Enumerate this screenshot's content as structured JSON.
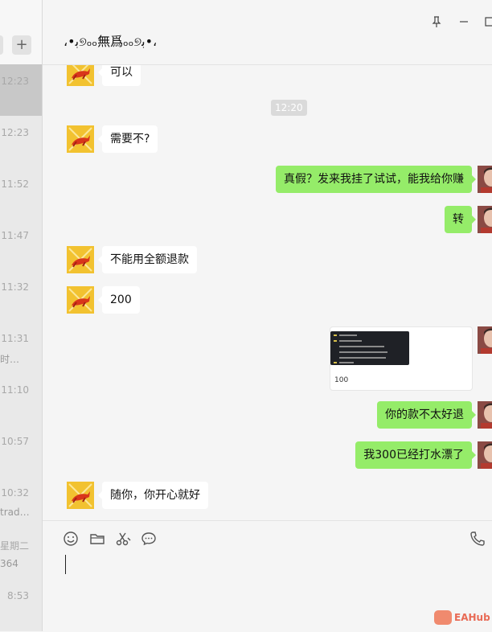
{
  "sidebar": {
    "plus_label": "+",
    "items": [
      {
        "time": "12:23",
        "active": true
      },
      {
        "time": "12:23"
      },
      {
        "time": "11:52"
      },
      {
        "time": "11:47"
      },
      {
        "time": "11:32"
      },
      {
        "time": "11:31",
        "preview": "时…"
      },
      {
        "time": "11:10"
      },
      {
        "time": "10:57"
      },
      {
        "time": "10:32",
        "preview": "trad…"
      },
      {
        "time": "星期二",
        "preview": "364"
      },
      {
        "time": "8:53"
      }
    ]
  },
  "chat": {
    "title": "،•ﺑ୭ₒₒ無爲ₒₒ୭ﺑ•،",
    "window_controls": {
      "pin": "⊥",
      "minimize": "—",
      "close": "□"
    },
    "timestamp": "12:20",
    "messages": [
      {
        "side": "in",
        "text": "可以"
      },
      {
        "side": "in",
        "text": "需要不?"
      },
      {
        "side": "out",
        "text": "真假？发来我挂了试试，能我给你赚"
      },
      {
        "side": "out",
        "text": "转"
      },
      {
        "side": "in",
        "text": "不能用全额退款"
      },
      {
        "side": "in",
        "text": "200"
      },
      {
        "side": "out",
        "type": "file",
        "count": "100"
      },
      {
        "side": "out",
        "text": "你的款不太好退"
      },
      {
        "side": "out",
        "text": "我300已经打水漂了"
      },
      {
        "side": "in",
        "text": "随你，你开心就好"
      }
    ]
  },
  "toolbar": {
    "icons": [
      "emoji-icon",
      "folder-icon",
      "scissors-icon",
      "chat-bubble-icon",
      "phone-icon"
    ]
  },
  "watermark": {
    "text": "EAHub"
  },
  "colors": {
    "out_bubble": "#95ec69",
    "in_bubble": "#ffffff",
    "background": "#f5f5f5",
    "sidebar": "#e9e9e9"
  }
}
